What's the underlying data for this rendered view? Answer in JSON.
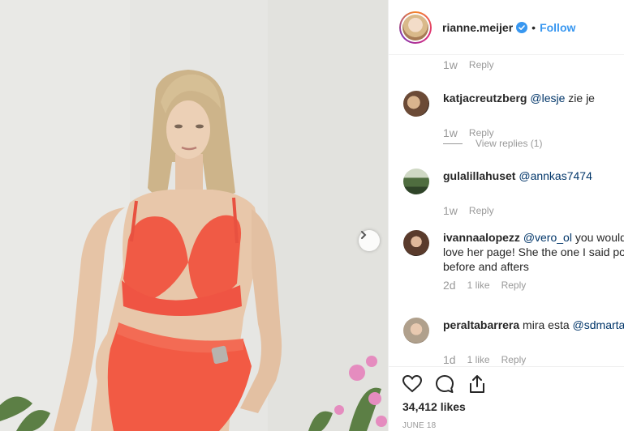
{
  "post": {
    "username": "rianne.meijer",
    "separator": "•",
    "follow_label": "Follow",
    "likes_text": "34,412 likes",
    "date_text": "JUNE 18"
  },
  "comments": {
    "top_meta": {
      "time": "1w",
      "reply": "Reply"
    },
    "items": [
      {
        "user": "katjacreutzberg",
        "mention": "@lesje",
        "text": " zie je",
        "time": "1w",
        "likes": "",
        "reply": "Reply",
        "view_replies": "View replies (1)"
      },
      {
        "user": "gulalillahuset",
        "mention": "@annkas7474",
        "text": "",
        "time": "1w",
        "likes": "",
        "reply": "Reply"
      },
      {
        "user": "ivannaalopezz",
        "mention": "@vero_ol",
        "text": " you would",
        "line2": "love her page! She the one I said pos",
        "line3": "before and afters",
        "time": "2d",
        "likes": "1 like",
        "reply": "Reply"
      },
      {
        "user": "peraltabarrera",
        "pre": " mira esta ",
        "mention": "@sdmarta",
        "text": "",
        "time": "1d",
        "likes": "1 like",
        "reply": "Reply"
      }
    ]
  },
  "icons": [
    "heart-icon",
    "comment-icon",
    "share-icon",
    "verified-badge-icon",
    "chevron-right-icon"
  ],
  "colors": {
    "link": "#3897f0",
    "mention": "#003569",
    "muted": "#999999",
    "lingerie": "#f05a45"
  }
}
